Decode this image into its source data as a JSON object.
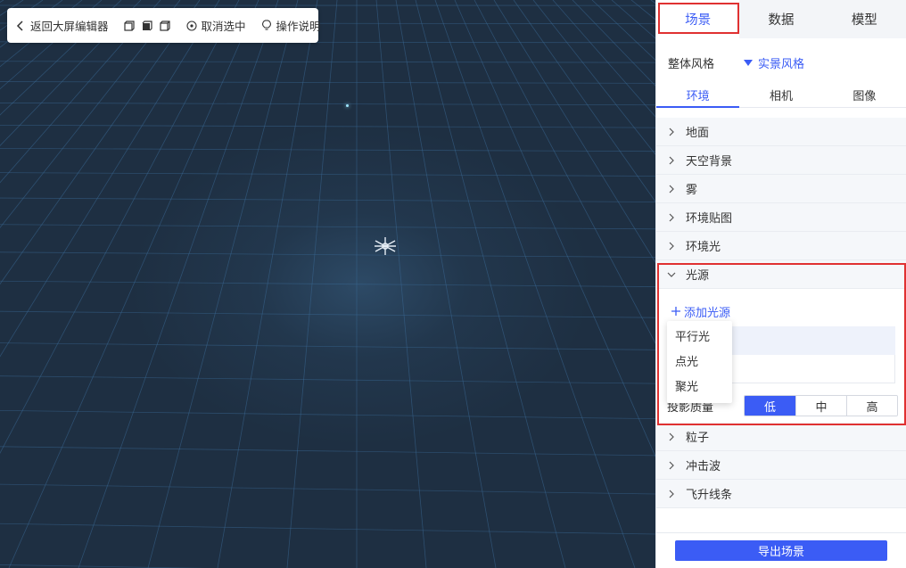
{
  "toolbar": {
    "back_label": "返回大屏编辑器",
    "deselect_label": "取消选中",
    "help_label": "操作说明"
  },
  "panel": {
    "main_tabs": [
      "场景",
      "数据",
      "模型"
    ],
    "active_main_tab": "场景",
    "style_label": "整体风格",
    "style_value": "实景风格",
    "sub_tabs": [
      "环境",
      "相机",
      "图像"
    ],
    "active_sub_tab": "环境",
    "accordion_before": [
      "地面",
      "天空背景",
      "雾",
      "环境贴图",
      "环境光"
    ],
    "light_section": {
      "title": "光源",
      "add_label": "添加光源",
      "dropdown_options": [
        "平行光",
        "点光",
        "聚光"
      ],
      "shadow_label": "投影质量",
      "shadow_options": [
        "低",
        "中",
        "高"
      ],
      "shadow_selected": "低"
    },
    "accordion_after": [
      "粒子",
      "冲击波",
      "飞升线条"
    ],
    "export_label": "导出场景"
  },
  "colors": {
    "accent": "#3b5cf5",
    "highlight": "#e03131",
    "viewport_bg": "#1f2e3f",
    "grid": "#3a6a95"
  }
}
